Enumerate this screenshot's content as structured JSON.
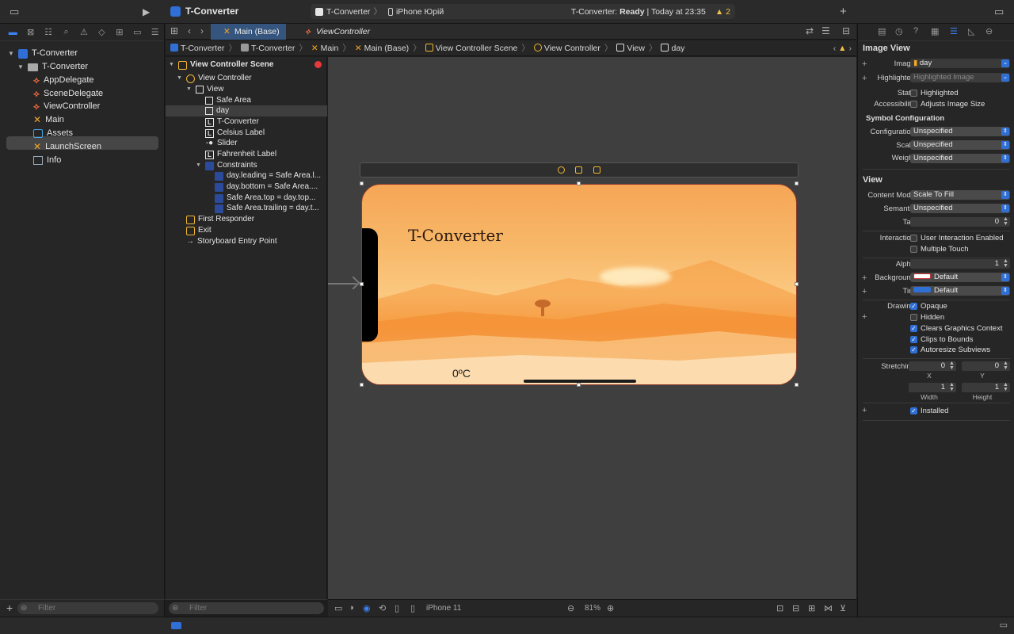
{
  "toolbar": {
    "project_title": "T-Converter",
    "scheme": "T-Converter",
    "device": "iPhone Юрій",
    "status_app": "T-Converter:",
    "status_state": "Ready",
    "status_time": "| Today at 23:35",
    "warning_count": "2"
  },
  "navigator": {
    "items": [
      {
        "label": "T-Converter",
        "icon": "project-icon"
      },
      {
        "label": "T-Converter",
        "icon": "folder-icon"
      },
      {
        "label": "AppDelegate",
        "icon": "swift-file-icon"
      },
      {
        "label": "SceneDelegate",
        "icon": "swift-file-icon"
      },
      {
        "label": "ViewController",
        "icon": "swift-file-icon"
      },
      {
        "label": "Main",
        "icon": "storyboard-icon"
      },
      {
        "label": "Assets",
        "icon": "asset-catalog-icon"
      },
      {
        "label": "LaunchScreen",
        "icon": "storyboard-icon"
      },
      {
        "label": "Info",
        "icon": "plist-icon"
      }
    ],
    "filter_placeholder": "Filter"
  },
  "editor": {
    "tabs": [
      {
        "label": "Main (Base)",
        "active": true
      },
      {
        "label": "ViewController",
        "active": false
      }
    ],
    "breadcrumb": [
      "T-Converter",
      "T-Converter",
      "Main",
      "Main (Base)",
      "View Controller Scene",
      "View Controller",
      "View",
      "day"
    ]
  },
  "outline": {
    "items": [
      {
        "label": "View Controller Scene"
      },
      {
        "label": "View Controller"
      },
      {
        "label": "View"
      },
      {
        "label": "Safe Area"
      },
      {
        "label": "day"
      },
      {
        "label": "T-Converter"
      },
      {
        "label": "Celsius Label"
      },
      {
        "label": "Slider"
      },
      {
        "label": "Fahrenheit Label"
      },
      {
        "label": "Constraints"
      },
      {
        "label": "day.leading = Safe Area.l..."
      },
      {
        "label": "day.bottom = Safe Area...."
      },
      {
        "label": "Safe Area.top = day.top..."
      },
      {
        "label": "Safe Area.trailing = day.t..."
      },
      {
        "label": "First Responder"
      },
      {
        "label": "Exit"
      },
      {
        "label": "Storyboard Entry Point"
      }
    ],
    "filter_placeholder": "Filter"
  },
  "canvas": {
    "app_title": "T-Converter",
    "celsius_value": "0ºC",
    "device_label": "iPhone 11",
    "zoom": "81%"
  },
  "inspector": {
    "image_view": {
      "heading": "Image View",
      "image_label": "Image",
      "image_value": "day",
      "highlighted_label": "Highlighted",
      "highlighted_placeholder": "Highlighted Image",
      "state_label": "State",
      "state_option": "Highlighted",
      "accessibility_label": "Accessibility",
      "accessibility_option": "Adjusts Image Size",
      "symbol_heading": "Symbol Configuration",
      "configuration_label": "Configuration",
      "configuration_value": "Unspecified",
      "scale_label": "Scale",
      "scale_value": "Unspecified",
      "weight_label": "Weight",
      "weight_value": "Unspecified"
    },
    "view": {
      "heading": "View",
      "content_mode_label": "Content Mode",
      "content_mode_value": "Scale To Fill",
      "semantic_label": "Semantic",
      "semantic_value": "Unspecified",
      "tag_label": "Tag",
      "tag_value": "0",
      "interaction_label": "Interaction",
      "user_interaction": "User Interaction Enabled",
      "multiple_touch": "Multiple Touch",
      "alpha_label": "Alpha",
      "alpha_value": "1",
      "background_label": "Background",
      "background_value": "Default",
      "tint_label": "Tint",
      "tint_value": "Default",
      "drawing_label": "Drawing",
      "opaque": "Opaque",
      "hidden": "Hidden",
      "clears_graphics": "Clears Graphics Context",
      "clips_to_bounds": "Clips to Bounds",
      "autoresize": "Autoresize Subviews",
      "stretching_label": "Stretching",
      "stretch_x": "0",
      "stretch_y": "0",
      "x_caption": "X",
      "y_caption": "Y",
      "stretch_width": "1",
      "stretch_height": "1",
      "width_caption": "Width",
      "height_caption": "Height",
      "installed": "Installed"
    },
    "colors": {
      "background_swatch": "#ffffff",
      "tint_swatch": "#2f6fd6"
    }
  }
}
